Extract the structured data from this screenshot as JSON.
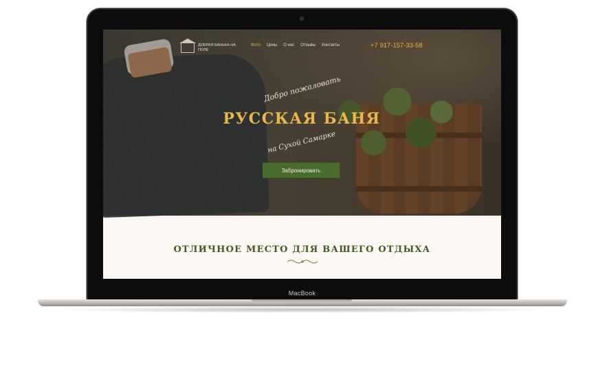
{
  "device": {
    "label": "MacBook"
  },
  "site": {
    "logo_text": "Добрая банька на поле",
    "nav": [
      {
        "label": "Фото",
        "active": true
      },
      {
        "label": "Цены",
        "active": false
      },
      {
        "label": "О нас",
        "active": false
      },
      {
        "label": "Отзывы",
        "active": false
      },
      {
        "label": "Контакты",
        "active": false
      }
    ],
    "phone": "+7 917-157-33-58",
    "hero": {
      "welcome": "Добро пожаловать",
      "title": "Русская баня",
      "subtitle": "на Сухой Самарке",
      "button": "Забронировать"
    },
    "section_title": "Отличное место для вашего отдыха"
  },
  "colors": {
    "accent_gold": "#e2b53a",
    "button_green": "#496c2c",
    "section_green": "#3f5a22",
    "page_background": "#fbf6f1"
  }
}
